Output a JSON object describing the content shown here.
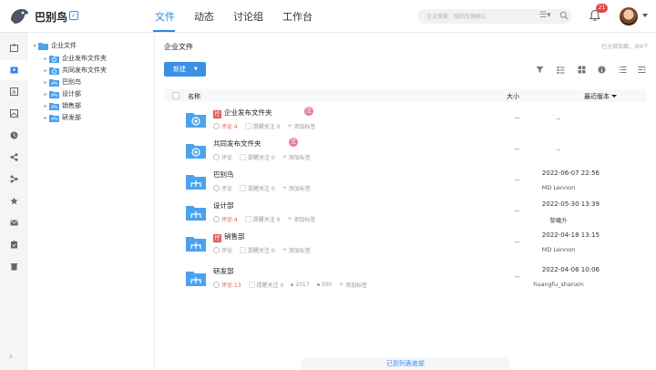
{
  "app": {
    "brand": "巴别鸟",
    "brand_badge": "✓"
  },
  "nav": {
    "tabs": [
      "文件",
      "动态",
      "讨论组",
      "工作台"
    ],
    "active": 0
  },
  "search": {
    "placeholder": "全文搜索，按回车键确认"
  },
  "notifications": {
    "count": "21"
  },
  "rail": {
    "icons": [
      "company-files-icon",
      "my-files-icon",
      "share-files-icon",
      "recent-icon",
      "shared-icon",
      "link-icon",
      "star-icon",
      "mail-icon",
      "tasks-icon",
      "trash-icon"
    ],
    "active": 1
  },
  "tree": {
    "root": "企业文件",
    "children": [
      "企业发布文件夹",
      "共同发布文件夹",
      "巴别鸟",
      "设计部",
      "销售部",
      "研发部"
    ]
  },
  "main": {
    "breadcrumb": "企业文件",
    "loaded_text": "已全部加载，共6个",
    "new_button": "新建",
    "columns": {
      "name": "名称",
      "size": "大小",
      "version": "最近版本"
    },
    "rows": [
      {
        "name": "企业发布文件夹",
        "ctrl": "控",
        "reg": "注",
        "comment": "评论 4",
        "comment_red": true,
        "follow": "提醒关注 0",
        "add_tag": "添加标签",
        "size": "--",
        "date": "",
        "user": "--",
        "icon": "special"
      },
      {
        "name": "共同发布文件夹",
        "ctrl": "",
        "reg": "注",
        "comment": "评论",
        "comment_red": false,
        "follow": "提醒关注 0",
        "add_tag": "添加标签",
        "size": "--",
        "date": "",
        "user": "--",
        "icon": "special"
      },
      {
        "name": "巴别鸟",
        "ctrl": "",
        "reg": "",
        "comment": "评论",
        "comment_red": false,
        "follow": "提醒关注 0",
        "add_tag": "添加标签",
        "size": "--",
        "date": "2022-06-07 22:56",
        "user": "MD Lennon",
        "icon": "team"
      },
      {
        "name": "设计部",
        "ctrl": "",
        "reg": "",
        "comment": "评论 4",
        "comment_red": true,
        "follow": "提醒关注 0",
        "add_tag": "添加标签",
        "size": "--",
        "date": "2022-05-30 13:39",
        "user": "黎曦升",
        "icon": "team"
      },
      {
        "name": "销售部",
        "ctrl": "控",
        "reg": "",
        "comment": "评论",
        "comment_red": false,
        "follow": "提醒关注 0",
        "add_tag": "添加标签",
        "size": "--",
        "date": "2022-04-18 13:15",
        "user": "MD Lennon",
        "icon": "team"
      },
      {
        "name": "研发部",
        "ctrl": "",
        "reg": "",
        "comment": "评论 13",
        "comment_red": true,
        "follow": "提醒关注 0",
        "tag1": "2017",
        "tag2": "300",
        "add_tag": "添加标签",
        "size": "--",
        "date": "2022-04-06 10:06",
        "user": "huangfu_shanxin",
        "icon": "team"
      }
    ],
    "bottom_text": "已到列表底部"
  },
  "colors": {
    "accent": "#2b87e3",
    "folder": "#4aa3ef",
    "danger": "#e05a5a",
    "reg_tag": "#e57ba8"
  }
}
